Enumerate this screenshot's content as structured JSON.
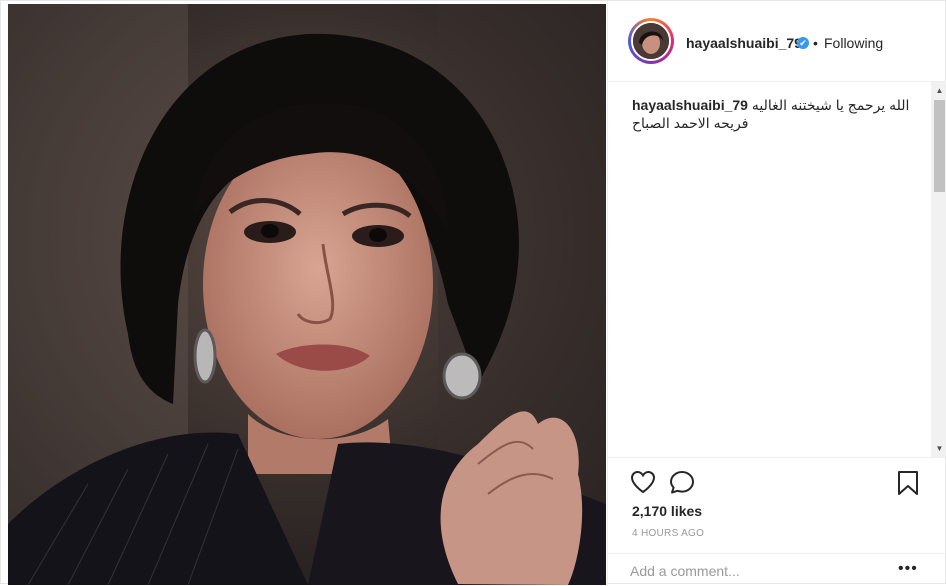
{
  "post": {
    "username": "hayaalshuaibi_79",
    "separator": "•",
    "follow_status": "Following",
    "verified_icon": "✔",
    "caption": {
      "username": "hayaalshuaibi_79",
      "text": "الله يرحمج يا شيختنه الغاليه فريحه الاحمد الصباح"
    },
    "likes": "2,170 likes",
    "timestamp": "4 HOURS AGO",
    "comment_placeholder": "Add a comment...",
    "more_label": "•••"
  },
  "scrollbar": {
    "up": "▲",
    "down": "▼"
  },
  "colors": {
    "accent": "#3897f0",
    "text": "#262626",
    "muted": "#999999",
    "border": "#efefef"
  }
}
